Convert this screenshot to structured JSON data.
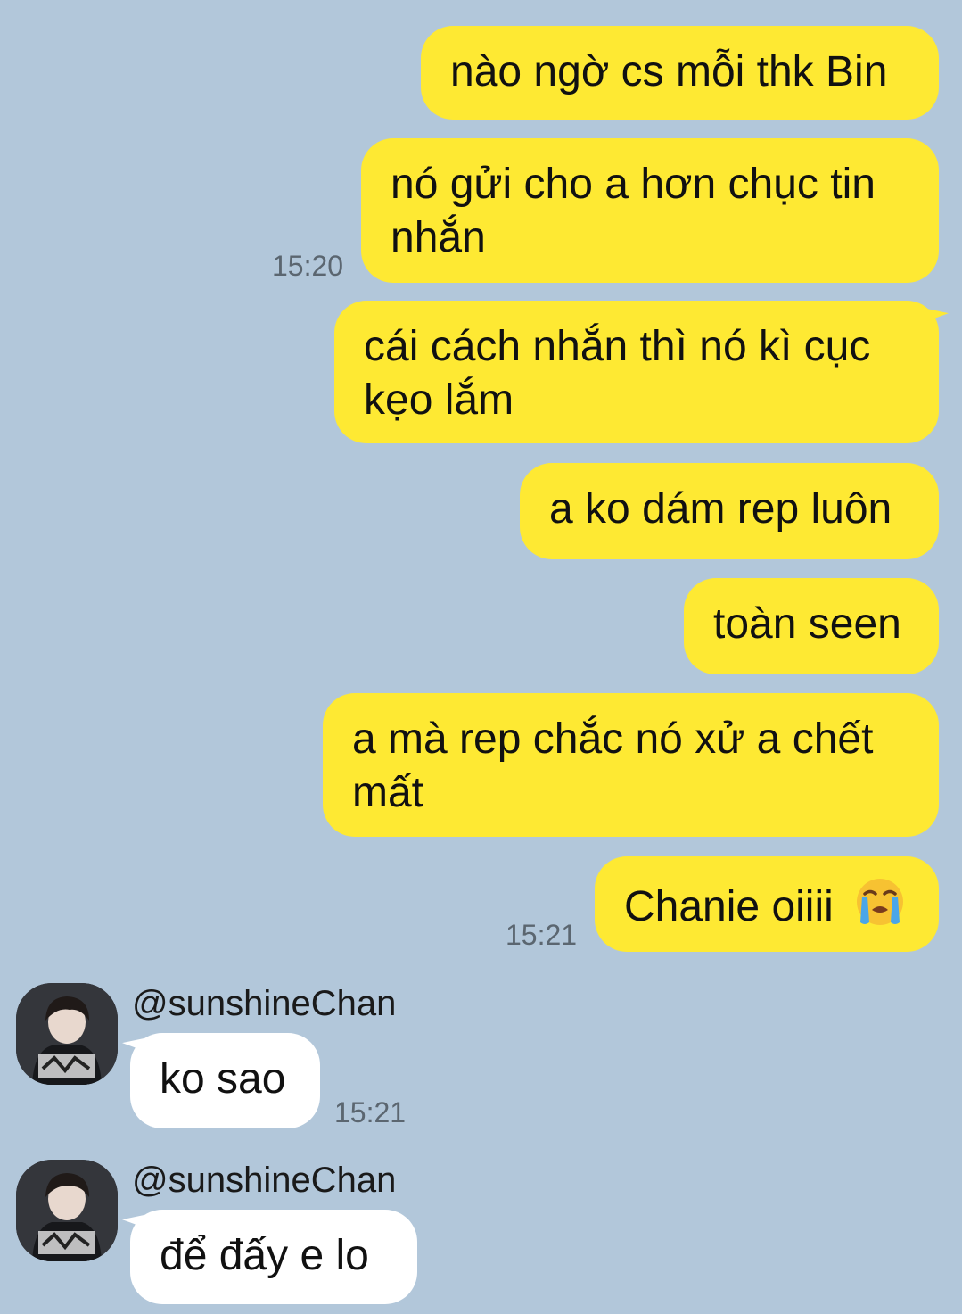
{
  "conversation": {
    "background_color": "#b2c7da",
    "sent_bubble_color": "#fee933",
    "received_bubble_color": "#ffffff",
    "messages": [
      {
        "direction": "sent",
        "text": "nào ngờ cs mỗi thk Bin",
        "time": ""
      },
      {
        "direction": "sent",
        "text": "nó gửi cho a hơn chục tin nhắn",
        "time": "15:20"
      },
      {
        "direction": "sent",
        "text": "cái cách nhắn thì nó kì cục kẹo lắm",
        "time": ""
      },
      {
        "direction": "sent",
        "text": "a ko dám rep luôn",
        "time": ""
      },
      {
        "direction": "sent",
        "text": "toàn seen",
        "time": ""
      },
      {
        "direction": "sent",
        "text": "a mà rep chắc nó xử a chết mất",
        "time": ""
      },
      {
        "direction": "sent",
        "text": "Chanie oiiii",
        "emoji": "loudly-crying-face-emoji",
        "time": "15:21"
      },
      {
        "direction": "received",
        "sender": "@sunshineChan",
        "text": "ko sao",
        "time": "15:21"
      },
      {
        "direction": "received",
        "sender": "@sunshineChan",
        "text": "để đấy e lo",
        "time": ""
      }
    ]
  }
}
